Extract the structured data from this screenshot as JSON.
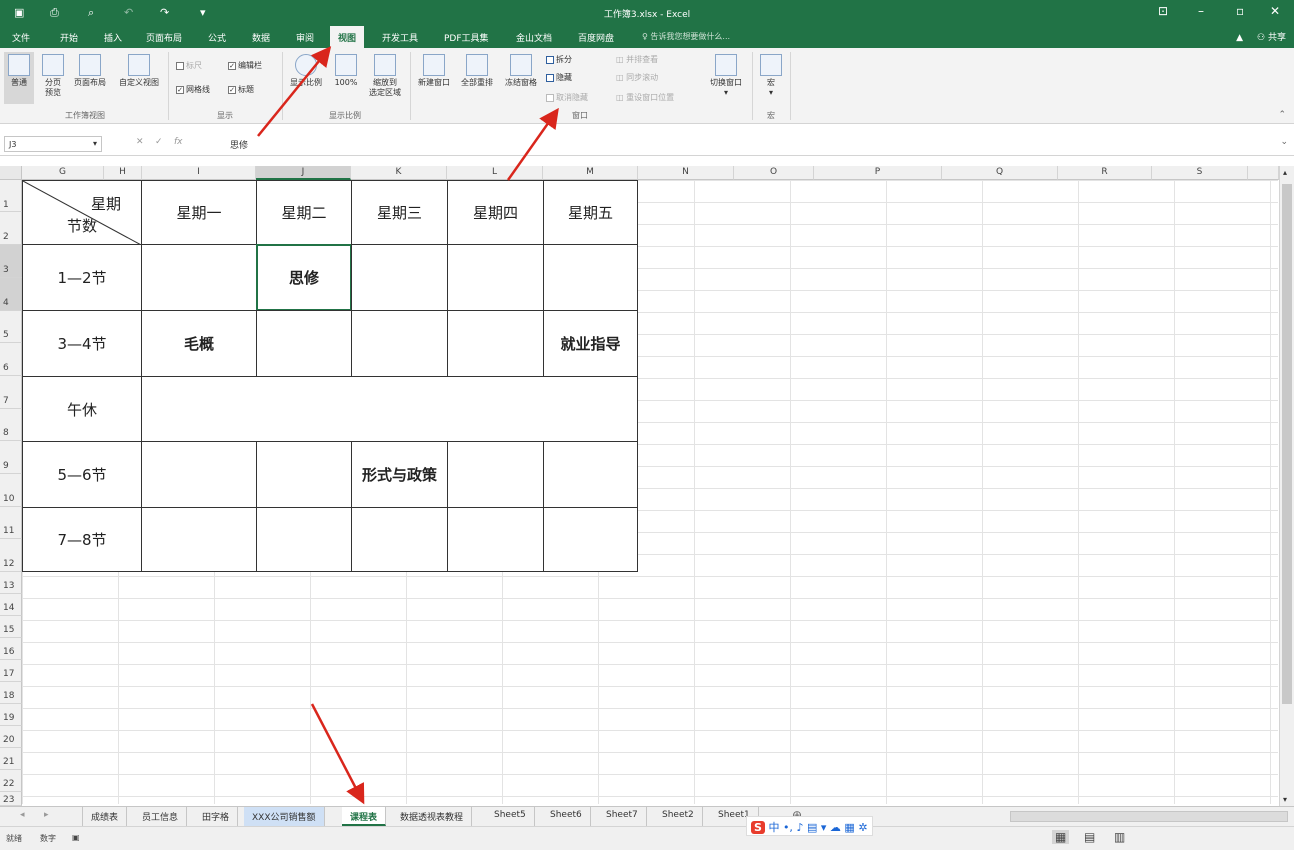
{
  "titlebar": {
    "title": "工作簿3.xlsx - Excel"
  },
  "tabs": [
    "文件",
    "开始",
    "插入",
    "页面布局",
    "公式",
    "数据",
    "审阅",
    "视图",
    "开发工具",
    "PDF工具集",
    "金山文档",
    "百度网盘"
  ],
  "tellme": "告诉我您想要做什么...",
  "share": "共享",
  "ribbon": {
    "workbook_views": {
      "normal": "普通",
      "page_break": "分页\n预览",
      "page_layout": "页面布局",
      "custom": "自定义视图",
      "group": "工作簿视图"
    },
    "show": {
      "ruler": "标尺",
      "formula_bar": "编辑栏",
      "gridlines": "网格线",
      "headings": "标题",
      "group": "显示"
    },
    "zoom": {
      "zoom": "显示比例",
      "hundred": "100%",
      "to_selection": "缩放到\n选定区域",
      "group": "显示比例"
    },
    "window": {
      "new": "新建窗口",
      "arrange": "全部重排",
      "freeze": "冻结窗格",
      "split": "拆分",
      "hide": "隐藏",
      "unhide": "取消隐藏",
      "side_by_side": "并排查看",
      "sync_scroll": "同步滚动",
      "reset_pos": "重设窗口位置",
      "switch": "切换窗口",
      "group": "窗口"
    },
    "macro": {
      "label": "宏",
      "group": "宏"
    }
  },
  "formula": {
    "namebox": "J3",
    "value": "思修"
  },
  "columns": [
    "G",
    "H",
    "I",
    "J",
    "K",
    "L",
    "M",
    "N",
    "O",
    "P",
    "Q",
    "R",
    "S"
  ],
  "rows": [
    "1",
    "2",
    "3",
    "4",
    "5",
    "6",
    "7",
    "8",
    "9",
    "10",
    "11",
    "12",
    "13",
    "14",
    "15",
    "16",
    "17",
    "18",
    "19",
    "20",
    "21",
    "22",
    "23"
  ],
  "timetable": {
    "header_top": "星期",
    "header_bottom": "节数",
    "days": [
      "星期一",
      "星期二",
      "星期三",
      "星期四",
      "星期五"
    ],
    "periods": [
      "1—2节",
      "3—4节",
      "午休",
      "5—6节",
      "7—8节"
    ],
    "entries": {
      "sixiu": "思修",
      "maogai": "毛概",
      "jiuye": "就业指导",
      "xingshi": "形式与政策"
    }
  },
  "sheets": [
    "成绩表",
    "员工信息",
    "田字格",
    "XXX公司销售额",
    "课程表",
    "数据透视表教程",
    "Sheet5",
    "Sheet6",
    "Sheet7",
    "Sheet2",
    "Sheet1"
  ],
  "status": {
    "ready": "就绪",
    "mode": "数字"
  }
}
